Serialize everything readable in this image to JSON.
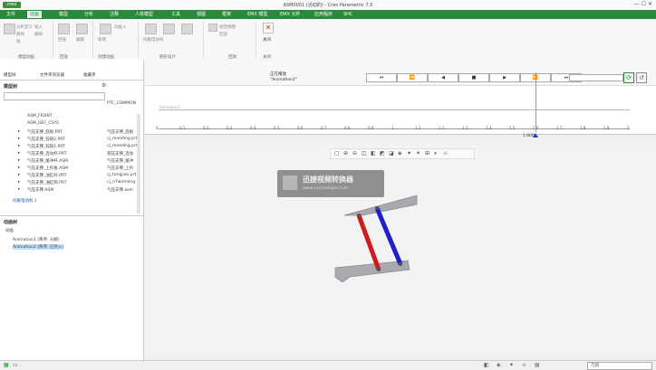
{
  "app": {
    "logo": "creo",
    "title": "ASM0001 (活动的) - Creo Parametric 7.0",
    "window_buttons": "— ☐ ✕"
  },
  "ribbon_tabs": [
    "文件",
    "动画",
    "模型",
    "分析",
    "注释",
    "人体模型",
    "工具",
    "视图",
    "框架",
    "EMX 模型",
    "EMX 元件",
    "应用程序",
    "SHC"
  ],
  "ribbon": {
    "groups": [
      "模型动画",
      "回放",
      "创建动画",
      "图形设计",
      "回放",
      "关闭"
    ],
    "buttons": [
      "分析定义",
      "移除",
      "组",
      "插入",
      "删除",
      "回放",
      "编辑",
      "新建",
      "动画 ▾",
      "伺服电动机",
      "加回视图",
      "回放",
      "关闭"
    ],
    "close_label": "关闭"
  },
  "nav": {
    "tabs": [
      "模型树",
      "文件夹浏览器",
      "收藏夹"
    ],
    "section_label": "模型树",
    "filter_column": "PTC_COMMON",
    "items": [
      {
        "name": "ASM_FRONT",
        "file": ""
      },
      {
        "name": "ASM_DEF_CSYS",
        "file": ""
      },
      {
        "name": "气压支撑_底板.PRT",
        "file": "气压支撑_底板"
      },
      {
        "name": "气压支撑_铰链2.PRT",
        "file": "cj_meeding.prt"
      },
      {
        "name": "气压支撑_铰链1.PRT",
        "file": "cj_meeding.prt"
      },
      {
        "name": "气压支撑_连动杆.PRT",
        "file": "液压支撑_连动"
      },
      {
        "name": "气压支撑_缓冲杆.ASM",
        "file": "气压支撑_缓冲"
      },
      {
        "name": "气压支撑_上托板.ASM",
        "file": "气压支撑_上托"
      },
      {
        "name": "气压支撑_油缸杆.PRT",
        "file": "cj_tongjian.prt"
      },
      {
        "name": "气压支撑_油缸筒.PRT",
        "file": "cj_n7wnmeng"
      },
      {
        "name": "气压支撑.ASM",
        "file": "气压支撑.asm"
      }
    ],
    "motor_item": "伺服电动机 1",
    "anim_section": "动画树",
    "anim_root": "动画",
    "anim_items": [
      "Animation1 (降序: 分解)",
      "Animation2 (降序: 已导入)"
    ]
  },
  "timeline": {
    "status": "正在播放",
    "anim_name": "\"Animation2\"",
    "controls": [
      "⏮",
      "⏪",
      "◀",
      "■",
      "▶",
      "⏩",
      "⏭"
    ],
    "ticks": [
      "0",
      "0.1",
      "0.2",
      "0.3",
      "0.4",
      "0.5",
      "0.6",
      "0.7",
      "0.8",
      "0.9",
      "1",
      "1.1",
      "1.2",
      "1.3",
      "1.4",
      "1.5",
      "1.6",
      "1.7",
      "1.8",
      "1.9",
      "2"
    ],
    "current_time": "1.600",
    "track_label": "Animation1",
    "progress_fraction": 0.8
  },
  "watermark": {
    "line1": "迅捷视频转换器",
    "line2": "www.xunjieshipin.com"
  },
  "status": {
    "mode": "几何"
  },
  "colors": {
    "brand": "#2a8a3c",
    "red_link": "#d11a1a",
    "blue_link": "#1f1fcc",
    "part_gray": "#a9a9b0"
  }
}
